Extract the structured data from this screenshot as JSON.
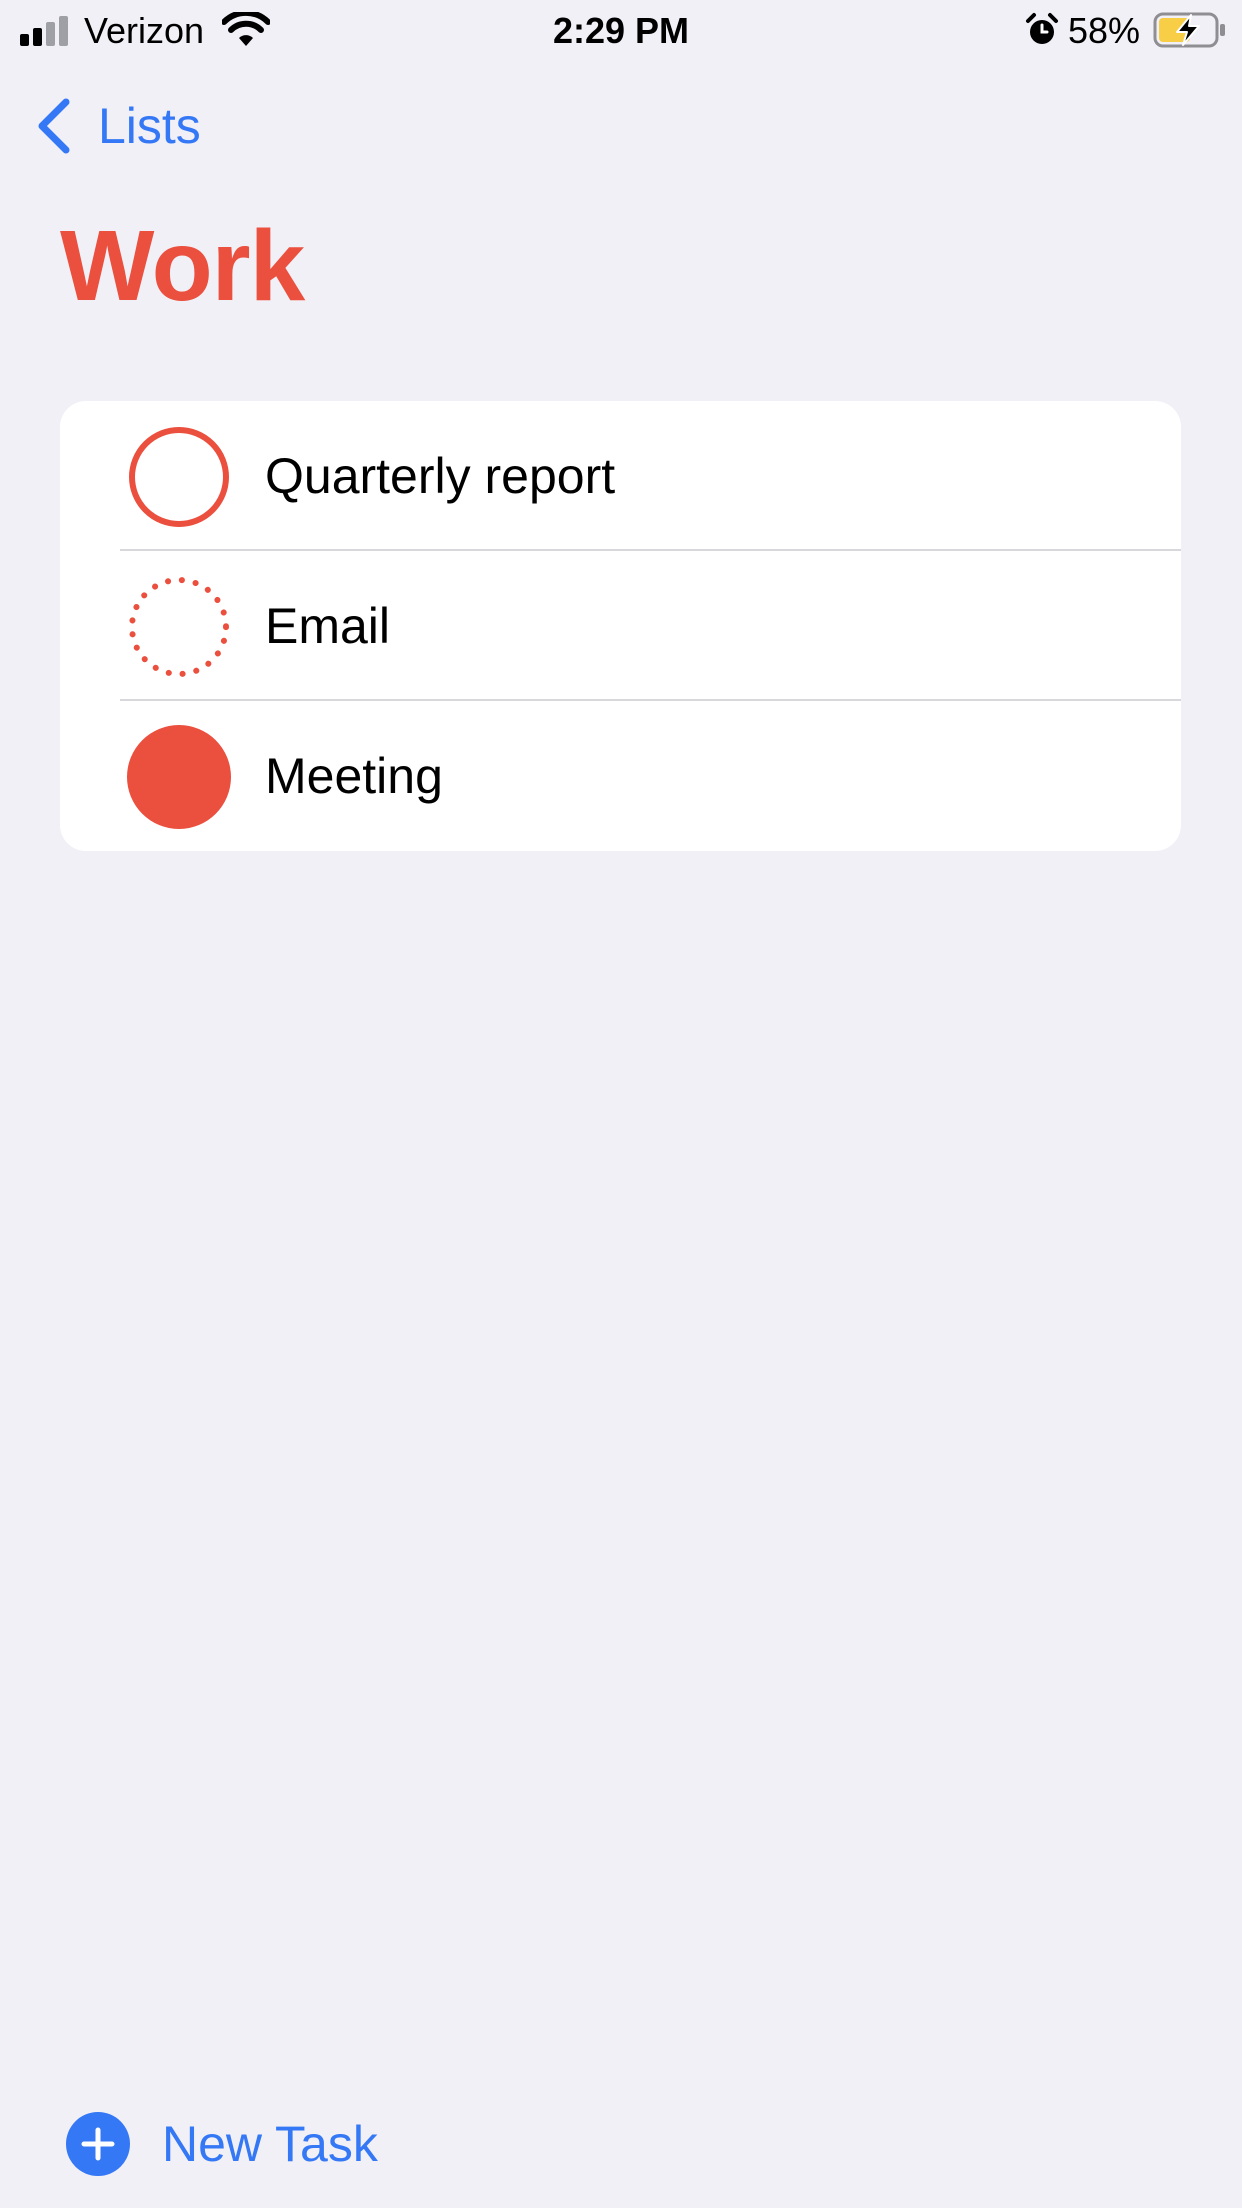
{
  "status_bar": {
    "carrier": "Verizon",
    "time": "2:29 PM",
    "battery_percent": "58%",
    "signal_bars_active": 2,
    "signal_bars_total": 4,
    "icons": [
      "signal-icon",
      "wifi-icon",
      "alarm-icon",
      "battery-charging-icon"
    ]
  },
  "nav": {
    "back_label": "Lists",
    "back_icon": "chevron-left-icon"
  },
  "list": {
    "title": "Work",
    "tasks": [
      {
        "label": "Quarterly report",
        "state": "incomplete"
      },
      {
        "label": "Email",
        "state": "pending"
      },
      {
        "label": "Meeting",
        "state": "completed"
      }
    ]
  },
  "toolbar": {
    "new_task_label": "New Task",
    "new_task_icon": "plus-circle-icon"
  },
  "colors": {
    "accent_red": "#eb4f3e",
    "accent_blue": "#3478f6",
    "background": "#f1f0f6",
    "card": "#ffffff"
  }
}
